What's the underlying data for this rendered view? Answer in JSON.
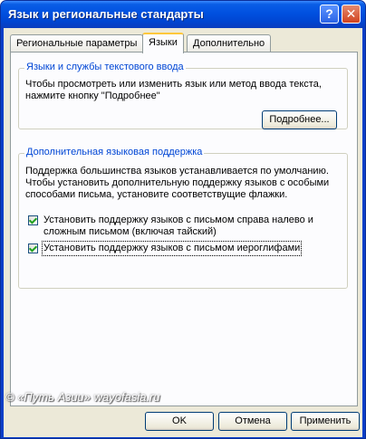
{
  "window": {
    "title": "Язык и региональные стандарты",
    "help_label": "?",
    "close_label": "✕"
  },
  "tabs": [
    {
      "label": "Региональные параметры",
      "active": false
    },
    {
      "label": "Языки",
      "active": true
    },
    {
      "label": "Дополнительно",
      "active": false
    }
  ],
  "text_services": {
    "legend": "Языки и службы текстового ввода",
    "description": "Чтобы просмотреть или изменить язык или метод ввода текста, нажмите кнопку \"Подробнее\"",
    "details_button": "Подробнее..."
  },
  "extra_support": {
    "legend": "Дополнительная языковая поддержка",
    "description": "Поддержка большинства языков устанавливается по умолчанию. Чтобы установить дополнительную поддержку языков с особыми способами письма, установите соответствущие флажки.",
    "checkboxes": [
      {
        "label": "Установить поддержку языков с письмом справа налево и сложным письмом (включая тайский)",
        "checked": true
      },
      {
        "label": "Установить поддержку языков с письмом иероглифами",
        "checked": true
      }
    ]
  },
  "watermark": "© «Путь Азии» wayofasia.ru",
  "buttons": {
    "ok": "OK",
    "cancel": "Отмена",
    "apply": "Применить"
  }
}
